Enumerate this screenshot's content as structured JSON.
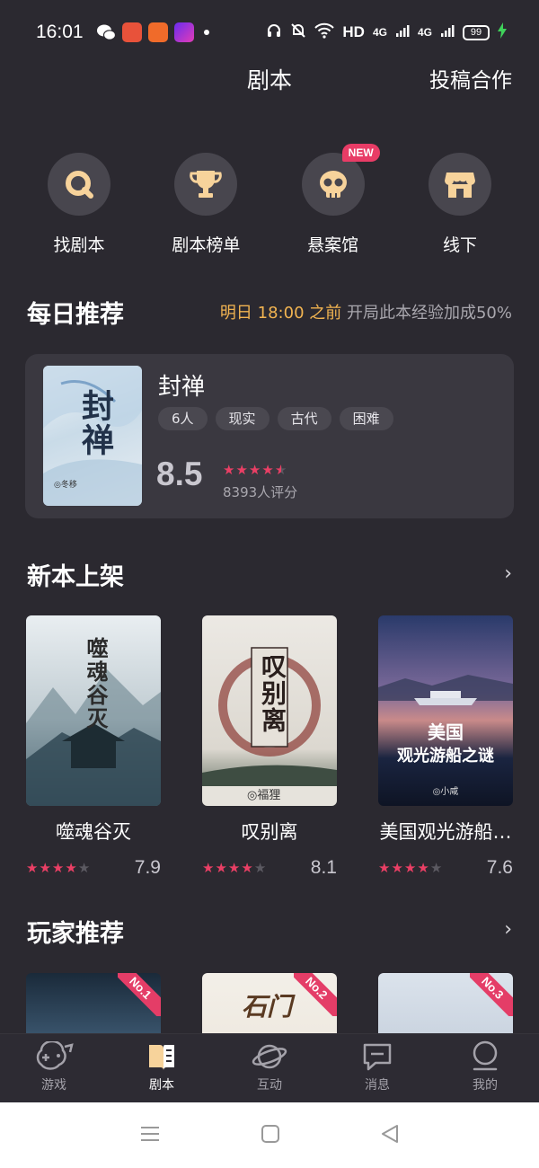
{
  "status_bar": {
    "time": "16:01",
    "hd_label": "HD",
    "signal1": "4G",
    "signal2": "4G",
    "battery": "99"
  },
  "header": {
    "title": "剧本",
    "action": "投稿合作"
  },
  "quick_nav": [
    {
      "label": "找剧本",
      "icon": "search-icon"
    },
    {
      "label": "剧本榜单",
      "icon": "trophy-icon"
    },
    {
      "label": "悬案馆",
      "icon": "skull-icon",
      "badge": "NEW"
    },
    {
      "label": "线下",
      "icon": "store-icon"
    }
  ],
  "daily": {
    "title": "每日推荐",
    "hint_time": "明日 18:00 之前",
    "hint_text": "开局此本经验加成50%",
    "book": {
      "cover_text": "封禅",
      "cover_author": "◎冬移",
      "name": "封禅",
      "tags": [
        "6人",
        "现实",
        "古代",
        "困难"
      ],
      "score": "8.5",
      "rating_count": "8393人评分"
    }
  },
  "new_section": {
    "title": "新本上架",
    "books": [
      {
        "title": "噬魂谷灭",
        "score": "7.9",
        "cover_text": "噬魂谷灭"
      },
      {
        "title": "叹别离",
        "score": "8.1",
        "cover_text": "叹别离",
        "cover_author": "◎福狸"
      },
      {
        "title": "美国观光游船…",
        "score": "7.6",
        "cover_text1": "美国",
        "cover_text2": "观光游船之谜",
        "cover_author": "◎小咸"
      }
    ]
  },
  "player_section": {
    "title": "玩家推荐",
    "books": [
      {
        "rank": "No.1"
      },
      {
        "rank": "No.2",
        "cover_text": "石门"
      },
      {
        "rank": "No.3"
      }
    ]
  },
  "tabbar": [
    {
      "label": "游戏",
      "icon": "gamepad-icon",
      "active": false
    },
    {
      "label": "剧本",
      "icon": "script-book-icon",
      "active": true
    },
    {
      "label": "互动",
      "icon": "planet-icon",
      "active": false
    },
    {
      "label": "消息",
      "icon": "message-icon",
      "active": false
    },
    {
      "label": "我的",
      "icon": "profile-icon",
      "active": false
    }
  ],
  "colors": {
    "background": "#2b2930",
    "accent_star": "#ea3f65",
    "hint_accent": "#f2b451",
    "badge": "#e83c66"
  }
}
